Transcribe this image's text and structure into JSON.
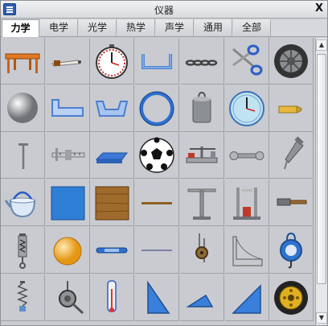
{
  "window": {
    "title": "仪器",
    "close_label": "X",
    "menu_icon": "menu-icon"
  },
  "tabs": [
    {
      "label": "力学",
      "active": true
    },
    {
      "label": "电学",
      "active": false
    },
    {
      "label": "光学",
      "active": false
    },
    {
      "label": "热学",
      "active": false
    },
    {
      "label": "声学",
      "active": false
    },
    {
      "label": "通用",
      "active": false
    },
    {
      "label": "全部",
      "active": false
    }
  ],
  "instruments": [
    {
      "icon": "table-icon",
      "row": 1
    },
    {
      "icon": "pen-icon",
      "row": 1
    },
    {
      "icon": "stopwatch-icon",
      "row": 1
    },
    {
      "icon": "u-channel-icon",
      "row": 1
    },
    {
      "icon": "chain-icon",
      "row": 1
    },
    {
      "icon": "scissors-icon",
      "row": 1
    },
    {
      "icon": "wheel-icon",
      "row": 1
    },
    {
      "icon": "steel-ball-icon",
      "row": 2
    },
    {
      "icon": "trough-icon",
      "row": 2
    },
    {
      "icon": "tray-icon",
      "row": 2
    },
    {
      "icon": "ring-icon",
      "row": 2
    },
    {
      "icon": "weight-icon",
      "row": 2
    },
    {
      "icon": "clock-icon",
      "row": 2
    },
    {
      "icon": "bullet-icon",
      "row": 2
    },
    {
      "icon": "nail-icon",
      "row": 3
    },
    {
      "icon": "caliper-icon",
      "row": 3
    },
    {
      "icon": "block-icon",
      "row": 3
    },
    {
      "icon": "soccer-ball-icon",
      "row": 3
    },
    {
      "icon": "balance-icon",
      "row": 3
    },
    {
      "icon": "wrench-icon",
      "row": 3
    },
    {
      "icon": "screw-icon",
      "row": 3
    },
    {
      "icon": "kettle-icon",
      "row": 4
    },
    {
      "icon": "blue-board-icon",
      "row": 4
    },
    {
      "icon": "wooden-board-icon",
      "row": 4
    },
    {
      "icon": "rod-icon",
      "row": 4
    },
    {
      "icon": "stand-icon",
      "row": 4
    },
    {
      "icon": "pulley-frame-icon",
      "row": 4
    },
    {
      "icon": "hammer-icon",
      "row": 4
    },
    {
      "icon": "spring-scale-icon",
      "row": 5
    },
    {
      "icon": "orange-ball-icon",
      "row": 5
    },
    {
      "icon": "blue-bar-icon",
      "row": 5
    },
    {
      "icon": "thin-rod-icon",
      "row": 5
    },
    {
      "icon": "pulley-icon",
      "row": 5
    },
    {
      "icon": "incline-icon",
      "row": 5
    },
    {
      "icon": "hanging-scale-icon",
      "row": 5
    },
    {
      "icon": "spring-icon",
      "row": 6
    },
    {
      "icon": "roller-icon",
      "row": 6
    },
    {
      "icon": "thermometer-icon",
      "row": 6
    },
    {
      "icon": "triangle-tall-icon",
      "row": 6
    },
    {
      "icon": "triangle-flat-icon",
      "row": 6
    },
    {
      "icon": "triangle-ruler-icon",
      "row": 6
    },
    {
      "icon": "car-wheel-icon",
      "row": 6
    }
  ],
  "colors": {
    "accent": "#2f5fb3",
    "grid_bg": "#c9cbd0",
    "grid_line": "#9fa2a7"
  }
}
